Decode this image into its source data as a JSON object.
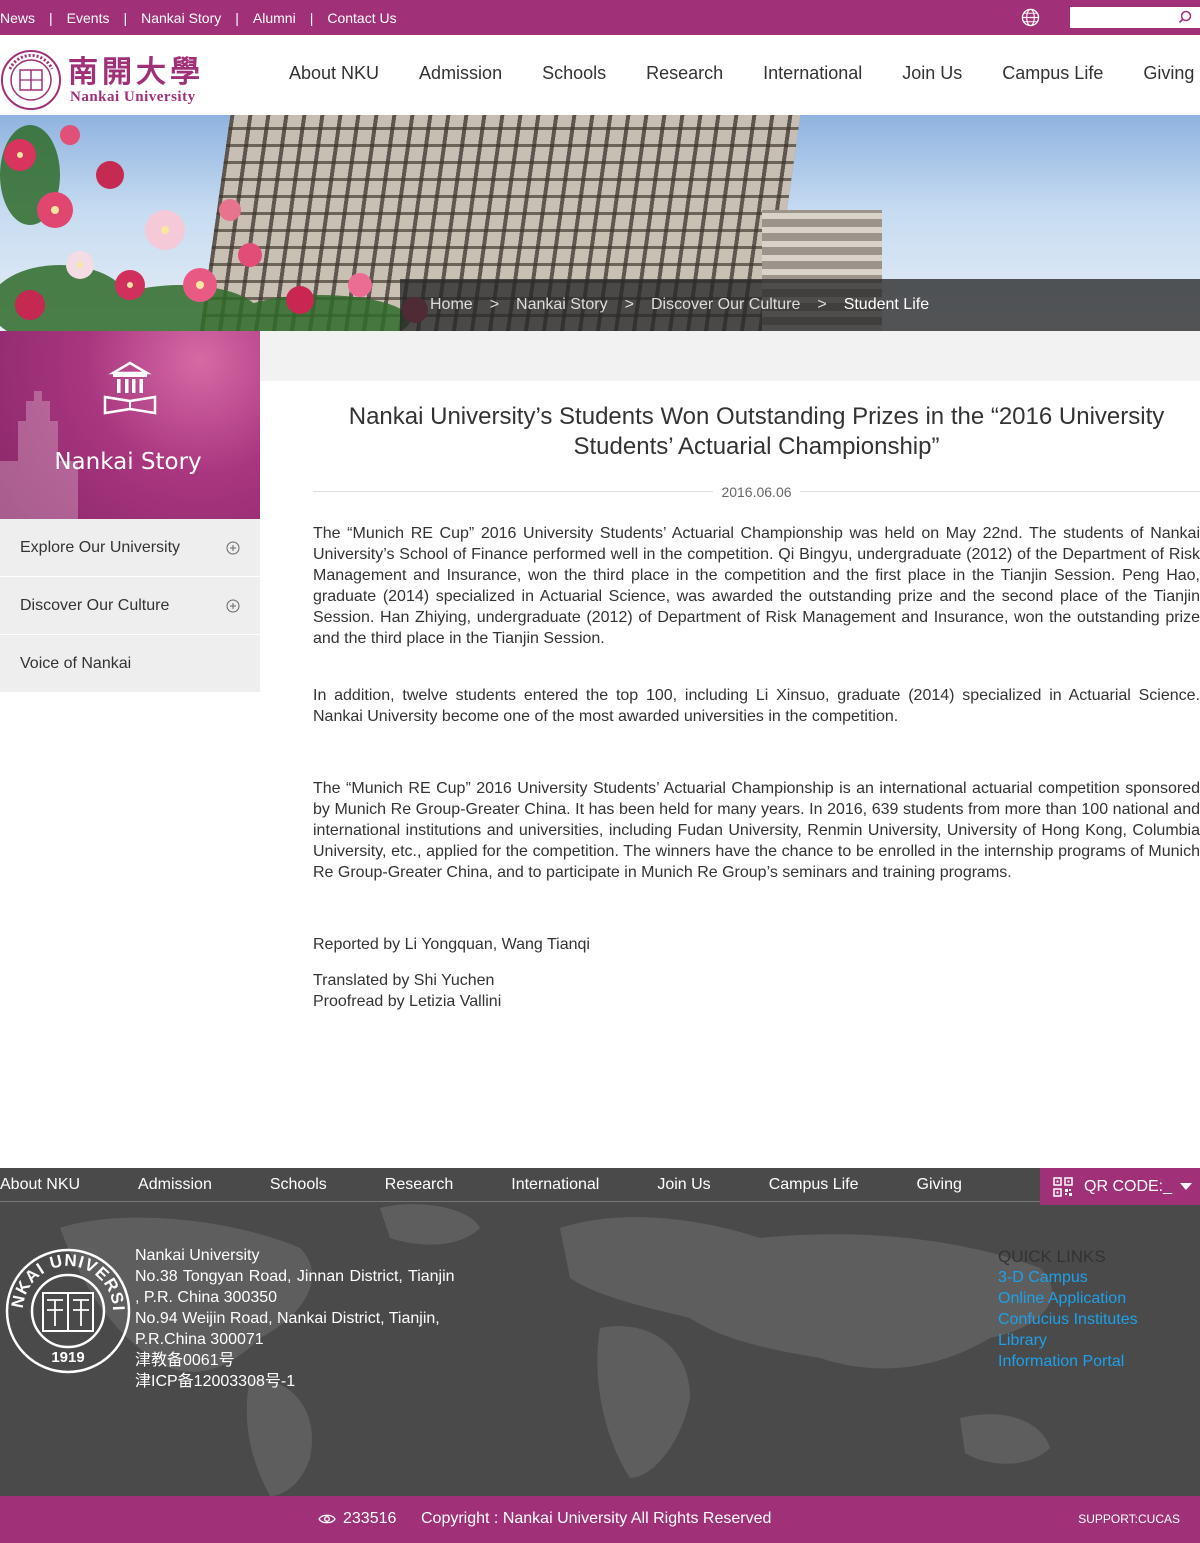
{
  "topbar": {
    "links": [
      "News",
      "Events",
      "Nankai Story",
      "Alumni",
      "Contact Us"
    ],
    "search_placeholder": ""
  },
  "logo": {
    "chinese": "南開大學",
    "english": "Nankai University"
  },
  "main_nav": [
    "About NKU",
    "Admission",
    "Schools",
    "Research",
    "International",
    "Join Us",
    "Campus Life",
    "Giving"
  ],
  "breadcrumb": {
    "items": [
      "Home",
      "Nankai Story",
      "Discover Our Culture",
      "Student Life"
    ],
    "separator": ">"
  },
  "sidebar": {
    "title": "Nankai Story",
    "items": [
      {
        "label": "Explore Our University",
        "expandable": true
      },
      {
        "label": "Discover Our Culture",
        "expandable": true
      },
      {
        "label": "Voice of Nankai",
        "expandable": false
      }
    ]
  },
  "article": {
    "title": "Nankai University’s Students Won Outstanding Prizes in the “2016 University Students’ Actuarial Championship”",
    "date": "2016.06.06",
    "paragraphs": [
      "The “Munich RE Cup” 2016 University Students’ Actuarial Championship was held on May 22nd. The students of Nankai University’s School of Finance performed well in the competition. Qi Bingyu, undergraduate (2012) of the Department of Risk Management and Insurance, won the third place in the competition and the first place in the Tianjin Session. Peng Hao, graduate (2014) specialized in Actuarial Science, was awarded the outstanding prize and the second place of the Tianjin Session. Han Zhiying, undergraduate (2012) of Department of Risk Management and Insurance, won the outstanding prize and the third place in the Tianjin Session.",
      "In addition, twelve students entered the top 100, including Li Xinsuo, graduate (2014) specialized in Actuarial Science. Nankai University become one of the most awarded universities in the competition.",
      "The “Munich RE Cup” 2016 University Students’ Actuarial Championship is an international actuarial competition sponsored by Munich Re Group-Greater China. It has been held for many years. In 2016, 639 students from more than 100 national and international institutions and universities, including Fudan University, Renmin University, University of Hong Kong, Columbia University, etc., applied for the competition. The winners have the chance to be enrolled in the internship programs of Munich Re Group-Greater China, and to participate in Munich Re Group’s seminars and training programs."
    ],
    "reported_by": "Reported by Li Yongquan, Wang Tianqi",
    "translated_by": "Translated by Shi Yuchen",
    "proofread_by": "Proofread by Letizia Vallini"
  },
  "footer": {
    "nav": [
      "About NKU",
      "Admission",
      "Schools",
      "Research",
      "International",
      "Join Us",
      "Campus Life",
      "Giving"
    ],
    "qr_label": "QR CODE:_",
    "address_lines": [
      "Nankai University",
      "No.38 Tongyan Road, Jinnan District, Tianjin",
      ", P.R. China 300350",
      "No.94 Weijin Road,  Nankai District, Tianjin,",
      "P.R.China  300071",
      "津教备0061号",
      "津ICP备12003308号-1"
    ],
    "quick_links_title": "QUICK LINKS",
    "quick_links": [
      "3-D Campus",
      "Online Application",
      "Confucius Institutes",
      "Library",
      "Information Portal"
    ],
    "seal_text": "NANKAI UNIVERSITY",
    "seal_year": "1919"
  },
  "bottom": {
    "visit_count": "233516",
    "copyright": "Copyright : Nankai University All Rights Reserved",
    "support": "SUPPORT:CUCAS"
  },
  "colors": {
    "brand": "#a03178",
    "footer_bg": "#4a4a4a",
    "link_blue": "#1ea0e8"
  },
  "icons": [
    "globe-icon",
    "search-icon",
    "library-icon",
    "plus-circle-icon",
    "qr-code-icon",
    "chevron-down-icon",
    "eye-icon"
  ]
}
